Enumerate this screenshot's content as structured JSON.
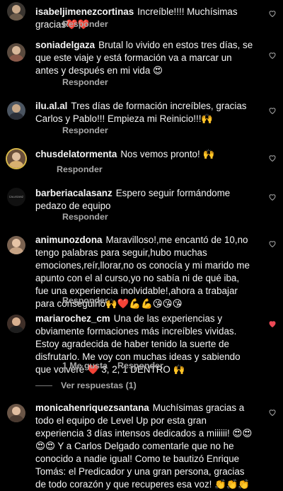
{
  "comments": [
    {
      "username": "isabeljimenezcortinas",
      "text": "Increíble!!!! Muchísimas gracias❤️❤️",
      "reply_label": "Responder",
      "liked": false
    },
    {
      "username": "soniadelgaza",
      "text": "Brutal lo vivido en estos tres días, se que este viaje y está formación va a marcar un antes y después en mi vida 😍",
      "reply_label": "Responder",
      "liked": false
    },
    {
      "username": "ilu.al.al",
      "text": "Tres días de formación increíbles, gracias Carlos y Pablo!!! Empieza mi Reinicio!!!🙌",
      "reply_label": "Responder",
      "liked": false
    },
    {
      "username": "chusdelatormenta",
      "text": "Nos vemos pronto! 🙌",
      "reply_label": "Responder",
      "liked": false
    },
    {
      "username": "barberiacalasanz",
      "text": "Espero seguir formándome pedazo de equipo",
      "reply_label": "Responder",
      "liked": false,
      "avatar_logo_text": "CALASANZ"
    },
    {
      "username": "animunozdona",
      "text": "Maravilloso!,me encantó de 10,no tengo palabras para seguir,hubo muchas emociones,reír,llorar,no os conocía y mi marido me apunto con el al curso,yo no sabía ni de qué iba, fue una experiencia inolvidable!,ahora a trabajar para conseguirlo🙌❤️💪💪😘😘😘",
      "reply_label": "Responder",
      "liked": false
    },
    {
      "username": "mariarochez_cm",
      "text": "Una de las experiencias y obviamente formaciones más increíbles vividas. Estoy agradecida de haber tenido la suerte de disfrutarlo. Me voy con muchas ideas y sabiendo que volveré ❤️ 3, 2, 1 DENTRO 🙌",
      "like_count_label": "1 Me gusta",
      "reply_label": "Responder",
      "liked": true,
      "view_replies_label": "Ver respuestas (1)"
    },
    {
      "username": "monicahenriquezsantana",
      "text": "Muchísimas gracias a todo el equipo de Level Up por esta gran experiencia 3 días intensos dedicados a miiiiii! 😍😍😍😍 Y a Carlos Delgado comentarle que no he conocido a nadie igual! Como te bautizó Enrique Tomás: el Predicador y una gran persona, gracias de todo corazón y que recuperes esa voz! 👏👏👏",
      "reply_label": "Responder",
      "liked": false
    }
  ],
  "colors": {
    "background": "#000000",
    "text": "#f5f5f5",
    "muted": "#a8a8a8",
    "liked_heart": "#ed4956"
  }
}
